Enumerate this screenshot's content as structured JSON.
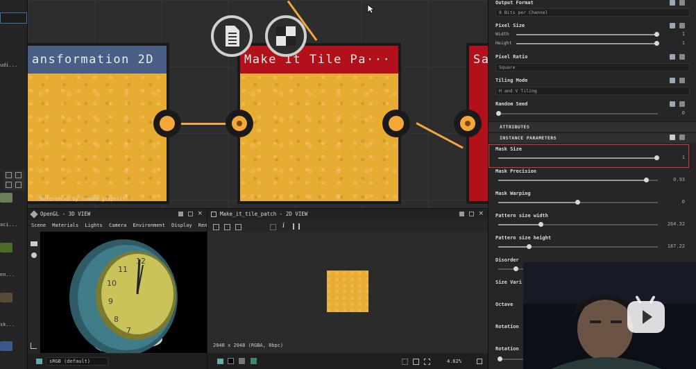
{
  "graph": {
    "node1_title": "ansformation 2D",
    "node2_title": "Make It Tile Pa···",
    "node3_title": "Sa",
    "referenced_text": "Referenced by loaded graph(s)",
    "colors": {
      "node1_header": "#4a5f86",
      "node2_header": "#b2101a",
      "node3_header": "#b2101a",
      "wire": "#f4a83c"
    }
  },
  "left_strip": {
    "labels": [
      "udi...",
      "aci...",
      "en...",
      "sk..."
    ]
  },
  "view3d": {
    "title": "OpenGL - 3D VIEW",
    "menu": [
      "Scene",
      "Materials",
      "Lights",
      "Camera",
      "Environment",
      "Display",
      "Renderer"
    ],
    "colorspace": "sRGB (default)"
  },
  "view2d": {
    "title": "Make_it_tile_patch - 2D VIEW",
    "resolution": "2048 x 2048 (RGBA, 8bpc)",
    "zoom": "4.62%"
  },
  "params": {
    "output_format": {
      "label": "Output Format",
      "value": "8 Bits per Channel"
    },
    "pixel_size": {
      "label": "Pixel Size",
      "width_label": "Width",
      "width_value": "1",
      "height_label": "Height",
      "height_value": "1"
    },
    "pixel_ratio": {
      "label": "Pixel Ratio",
      "value": "Square"
    },
    "tiling_mode": {
      "label": "Tiling Mode",
      "value": "H and V Tiling"
    },
    "random_seed": {
      "label": "Random Seed",
      "value": "0"
    },
    "attributes_label": "ATTRIBUTES",
    "instance_params_label": "INSTANCE PARAMETERS",
    "mask_size": {
      "label": "Mask Size",
      "value": "1",
      "fraction": 1.0
    },
    "mask_precision": {
      "label": "Mask Precision",
      "value": "0.93",
      "fraction": 0.93
    },
    "mask_warping": {
      "label": "Mask Warping",
      "value": "0",
      "fraction": 0.5
    },
    "pattern_width": {
      "label": "Pattern size width",
      "value": "264.32",
      "fraction": 0.26
    },
    "pattern_height": {
      "label": "Pattern size height",
      "value": "187.22",
      "fraction": 0.19
    },
    "disorder": {
      "label": "Disorder"
    },
    "size_var": {
      "label": "Size Vari"
    },
    "octave": {
      "label": "Octave"
    },
    "rotation1": {
      "label": "Rotation"
    },
    "rotation2": {
      "label": "Rotation"
    }
  }
}
